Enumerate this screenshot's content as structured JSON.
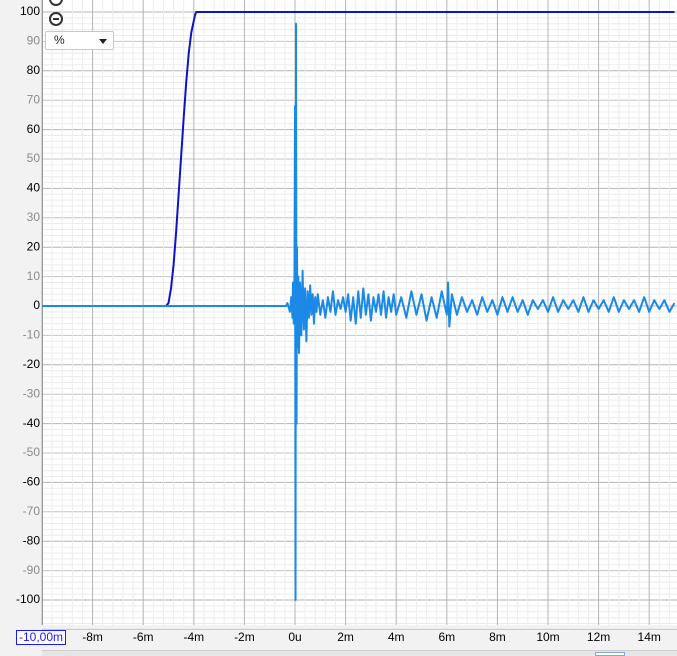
{
  "unit_selector": {
    "value": "%"
  },
  "x_start_value": "-10,00m",
  "chart_data": {
    "type": "line",
    "title": "",
    "xlabel": "",
    "ylabel": "",
    "xlim": [
      -10,
      15
    ],
    "ylim": [
      -110,
      100
    ],
    "x_unit": "ms",
    "grid": true,
    "y_ticks_major": [
      "100",
      "80",
      "60",
      "40",
      "20",
      "0",
      "-20",
      "-40",
      "-60",
      "-80",
      "-100"
    ],
    "y_ticks_minor": [
      "90",
      "70",
      "50",
      "30",
      "10",
      "-10",
      "-30",
      "-50",
      "-70",
      "-90"
    ],
    "x_ticks": [
      "-8m",
      "-6m",
      "-4m",
      "-2m",
      "0u",
      "2m",
      "4m",
      "6m",
      "8m",
      "10m",
      "12m",
      "14m"
    ],
    "series": [
      {
        "color": "#0a14c8",
        "x": [
          -10,
          -5.1,
          -5.0,
          -4.9,
          -4.8,
          -4.7,
          -4.6,
          -4.5,
          -4.4,
          -4.3,
          -4.2,
          -4.1,
          -4.0,
          -3.95,
          -3.9,
          -3.8,
          15
        ],
        "y": [
          0,
          0,
          1,
          6,
          14,
          25,
          38,
          51,
          64,
          76,
          86,
          93,
          97,
          99,
          100,
          100,
          100
        ]
      },
      {
        "color": "#1a8ae6",
        "x": [
          -10,
          -0.35,
          -0.3,
          -0.2,
          -0.15,
          -0.1,
          -0.08,
          -0.05,
          -0.02,
          0.0,
          0.02,
          0.04,
          0.06,
          0.08,
          0.1,
          0.13,
          0.16,
          0.2,
          0.25,
          0.3,
          0.35,
          0.4,
          0.45,
          0.5,
          0.55,
          0.6,
          0.65,
          0.7,
          0.75,
          0.8,
          0.85,
          0.9,
          1.0,
          1.1,
          1.2,
          1.3,
          1.4,
          1.5,
          1.6,
          1.7,
          1.8,
          1.9,
          2.0,
          2.1,
          2.2,
          2.3,
          2.4,
          2.5,
          2.6,
          2.7,
          2.8,
          2.9,
          3.0,
          3.1,
          3.2,
          3.3,
          3.4,
          3.5,
          3.6,
          3.7,
          3.8,
          3.9,
          4.0,
          4.2,
          4.4,
          4.6,
          4.8,
          5.0,
          5.2,
          5.4,
          5.6,
          5.8,
          6.0,
          6.05,
          6.1,
          6.2,
          6.4,
          6.6,
          6.8,
          7.0,
          7.2,
          7.4,
          7.6,
          7.8,
          8.0,
          8.2,
          8.4,
          8.6,
          8.8,
          9.0,
          9.2,
          9.4,
          9.6,
          9.8,
          10.0,
          10.2,
          10.4,
          10.6,
          10.8,
          11.0,
          11.2,
          11.4,
          11.6,
          11.8,
          12.0,
          12.2,
          12.4,
          12.6,
          12.8,
          13.0,
          13.2,
          13.4,
          13.6,
          13.8,
          14.0,
          14.2,
          14.4,
          14.6,
          14.8,
          15.0
        ],
        "y": [
          0,
          0,
          1,
          -2,
          3,
          -4,
          8,
          -6,
          12,
          68,
          -100,
          96,
          -40,
          20,
          -14,
          10,
          -16,
          8,
          -10,
          12,
          -8,
          6,
          -12,
          5,
          -4,
          7,
          -3,
          4,
          -6,
          3,
          -2,
          4,
          -3,
          2,
          -4,
          3,
          -2,
          5,
          -3,
          2,
          -1,
          3,
          -2,
          4,
          -5,
          3,
          -6,
          5,
          -4,
          6,
          -3,
          4,
          -5,
          3,
          -2,
          4,
          -3,
          5,
          -4,
          3,
          -2,
          4,
          -3,
          3,
          -4,
          5,
          -3,
          4,
          -5,
          3,
          -4,
          5,
          -3,
          8,
          -7,
          4,
          -3,
          3,
          -2,
          2,
          -3,
          3,
          -2,
          2,
          -3,
          3,
          -2,
          3,
          -2,
          2,
          -3,
          2,
          -1,
          2,
          -2,
          3,
          -2,
          2,
          -1,
          2,
          -2,
          3,
          -2,
          2,
          -1,
          2,
          -2,
          3,
          -2,
          2,
          -1,
          2,
          -2,
          3,
          -2,
          2,
          -1,
          2,
          -2,
          1
        ]
      }
    ]
  }
}
